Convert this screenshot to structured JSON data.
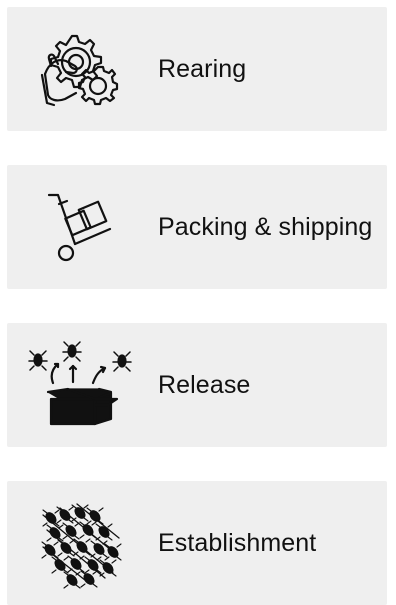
{
  "stages": [
    {
      "label": "Rearing",
      "icon": "gear-hand-icon"
    },
    {
      "label": "Packing & shipping",
      "icon": "hand-truck-boxes-icon"
    },
    {
      "label": "Release",
      "icon": "open-box-insects-icon"
    },
    {
      "label": "Establishment",
      "icon": "insect-colony-icon"
    }
  ],
  "colors": {
    "card_background": "#efefef",
    "icon_and_text": "#111111"
  }
}
